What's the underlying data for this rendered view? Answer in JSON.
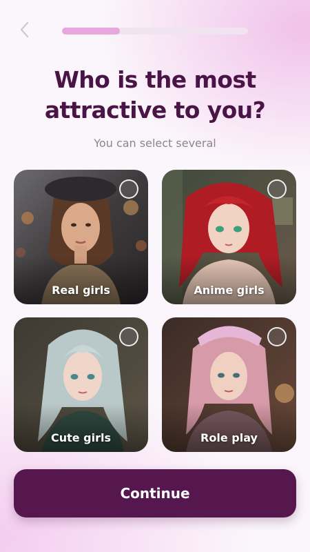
{
  "header": {
    "back_icon": "chevron-left-icon",
    "progress": 0.31
  },
  "title": "Who is the most attractive to you?",
  "subtitle": "You can select several",
  "options": [
    {
      "label": "Real girls",
      "selected": false
    },
    {
      "label": "Anime girls",
      "selected": false
    },
    {
      "label": "Cute girls",
      "selected": false
    },
    {
      "label": "Role play",
      "selected": false
    }
  ],
  "continue_label": "Continue",
  "colors": {
    "accent": "#55174e",
    "title": "#4a1446",
    "progress_fill": "#e7a6de",
    "progress_track": "#f0e4f0",
    "subtitle": "#8b8590"
  }
}
